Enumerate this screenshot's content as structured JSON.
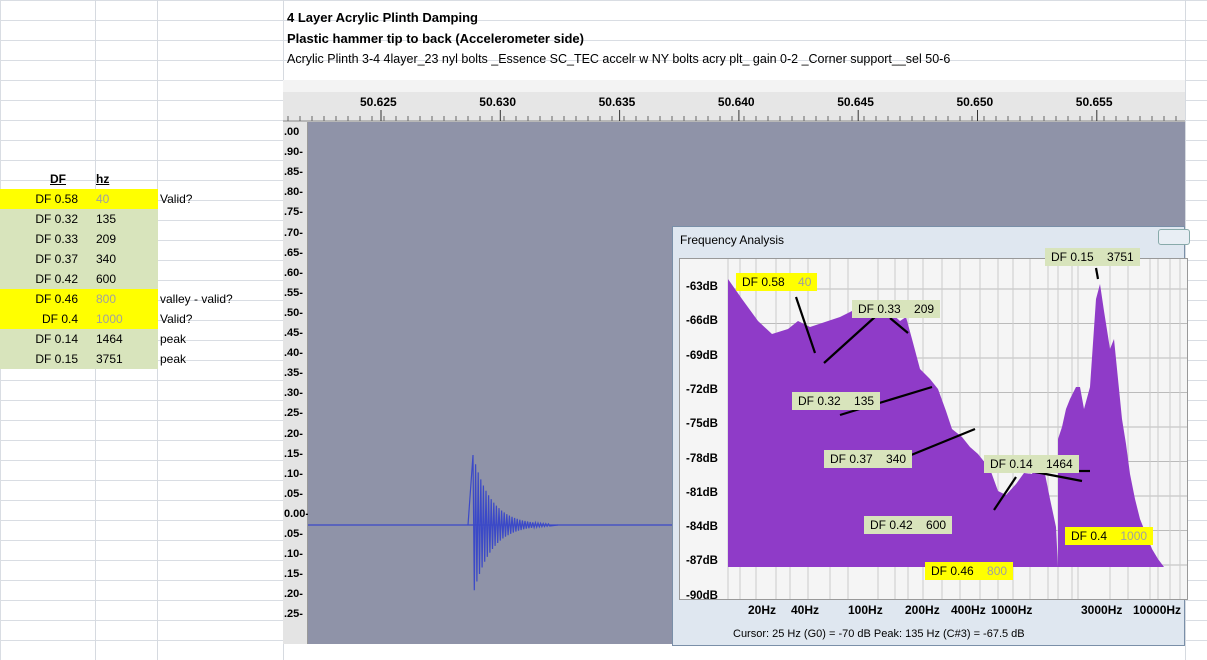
{
  "header": {
    "title": "4 Layer Acrylic Plinth Damping",
    "subtitle": "Plastic hammer tip to back (Accelerometer side)",
    "description": "Acrylic Plinth 3-4 4layer_23 nyl bolts _Essence SC_TEC accelr w NY bolts acry plt_ gain 0-2 _Corner support__sel 50-6"
  },
  "table": {
    "col_df": "DF",
    "col_hz": "hz",
    "rows": [
      {
        "df": "DF 0.58",
        "hz": "40",
        "note": "Valid?",
        "color": "#ffff00"
      },
      {
        "df": "DF 0.32",
        "hz": "135",
        "note": "",
        "color": "#d8e4bc"
      },
      {
        "df": "DF 0.33",
        "hz": "209",
        "note": "",
        "color": "#d8e4bc"
      },
      {
        "df": "DF 0.37",
        "hz": "340",
        "note": "",
        "color": "#d8e4bc"
      },
      {
        "df": "DF 0.42",
        "hz": "600",
        "note": "",
        "color": "#d8e4bc"
      },
      {
        "df": "DF 0.46",
        "hz": "800",
        "note": "valley - valid?",
        "color": "#ffff00"
      },
      {
        "df": "DF 0.4",
        "hz": "1000",
        "note": "Valid?",
        "color": "#ffff00"
      },
      {
        "df": "DF 0.14",
        "hz": "1464",
        "note": "peak",
        "color": "#d8e4bc"
      },
      {
        "df": "DF 0.15",
        "hz": "3751",
        "note": "peak",
        "color": "#d8e4bc"
      }
    ]
  },
  "audacity": {
    "ruler_labels": [
      "50.625",
      "50.630",
      "50.635",
      "50.640",
      "50.645",
      "50.650",
      "50.655"
    ],
    "amplitude_labels": [
      ".00",
      ".90-",
      ".85-",
      ".80-",
      ".75-",
      ".70-",
      ".65-",
      ".60-",
      ".55-",
      ".50-",
      ".45-",
      ".40-",
      ".35-",
      ".30-",
      ".25-",
      ".20-",
      ".15-",
      ".10-",
      ".05-",
      "0.00-",
      ".05-",
      ".10-",
      ".15-",
      ".20-",
      ".25-"
    ],
    "track_color": "#8f93a8",
    "wave_color": "#3b49c8"
  },
  "freq_window": {
    "title": "Frequency Analysis",
    "cursor_text": "Cursor: 25 Hz (G0) = -70 dB    Peak: 135 Hz (C#3) = -67.5 dB",
    "y_labels": [
      "-63dB",
      "-66dB",
      "-69dB",
      "-72dB",
      "-75dB",
      "-78dB",
      "-81dB",
      "-84dB",
      "-87dB",
      "-90dB"
    ],
    "x_labels": [
      "20Hz",
      "40Hz",
      "100Hz",
      "200Hz",
      "400Hz",
      "1000Hz",
      "3000Hz",
      "10000Hz"
    ],
    "spectrum_color": "#8f3bc8",
    "annotations": [
      {
        "df": "DF 0.58",
        "hz": "40",
        "style": "y"
      },
      {
        "df": "DF 0.33",
        "hz": "209",
        "style": "g"
      },
      {
        "df": "DF 0.15",
        "hz": "3751",
        "style": "g"
      },
      {
        "df": "DF 0.32",
        "hz": "135",
        "style": "g"
      },
      {
        "df": "DF 0.37",
        "hz": "340",
        "style": "g"
      },
      {
        "df": "DF 0.14",
        "hz": "1464",
        "style": "g"
      },
      {
        "df": "DF 0.42",
        "hz": "600",
        "style": "g"
      },
      {
        "df": "DF 0.4",
        "hz": "1000",
        "style": "y"
      },
      {
        "df": "DF 0.46",
        "hz": "800",
        "style": "y"
      }
    ]
  }
}
